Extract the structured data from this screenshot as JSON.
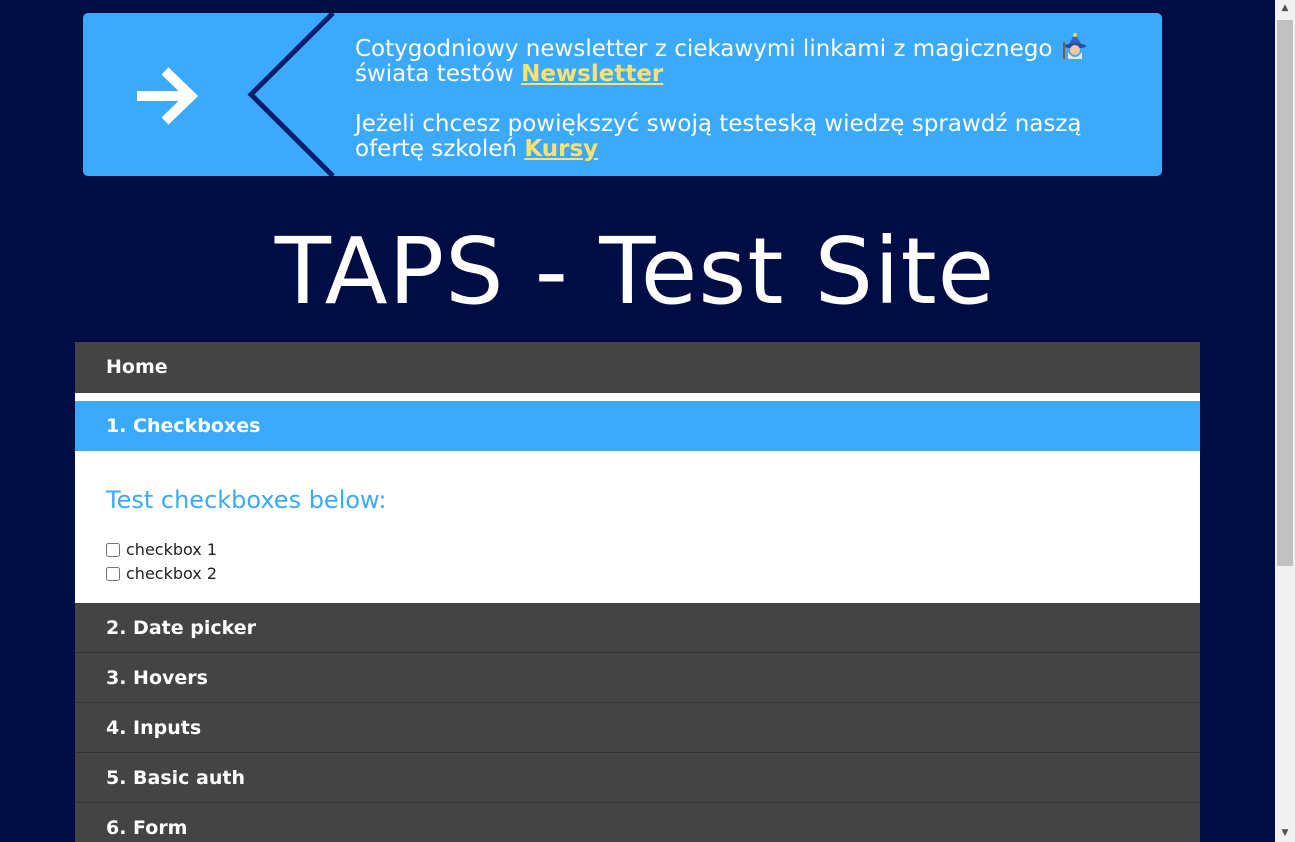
{
  "banner": {
    "line1_text": "Cotygodniowy newsletter z ciekawymi linkami z magicznego",
    "line1_text2": "świata testów",
    "newsletter_link": "Newsletter",
    "line2_text": "Jeżeli chcesz powiększyć swoją testeską wiedzę sprawdź naszą ofertę szkoleń",
    "courses_link": "Kursy",
    "arrow_icon": "arrow-right-icon",
    "wizard_icon": "wizard-emoji-icon",
    "link_color": "#ffe16f",
    "bg_color": "#3ba9fc"
  },
  "site": {
    "title": "TAPS - Test Site"
  },
  "menu": {
    "home": "Home",
    "active_section": "1. Checkboxes",
    "panel_heading": "Test checkboxes below:",
    "checkboxes": [
      {
        "label": "checkbox 1",
        "checked": false
      },
      {
        "label": "checkbox 2",
        "checked": false
      }
    ],
    "items": [
      {
        "label": "2. Date picker"
      },
      {
        "label": "3. Hovers"
      },
      {
        "label": "4. Inputs"
      },
      {
        "label": "5. Basic auth"
      },
      {
        "label": "6. Form"
      }
    ]
  },
  "colors": {
    "page_bg": "#000d45",
    "menu_bg": "#444444",
    "accent": "#3ba9fc"
  }
}
